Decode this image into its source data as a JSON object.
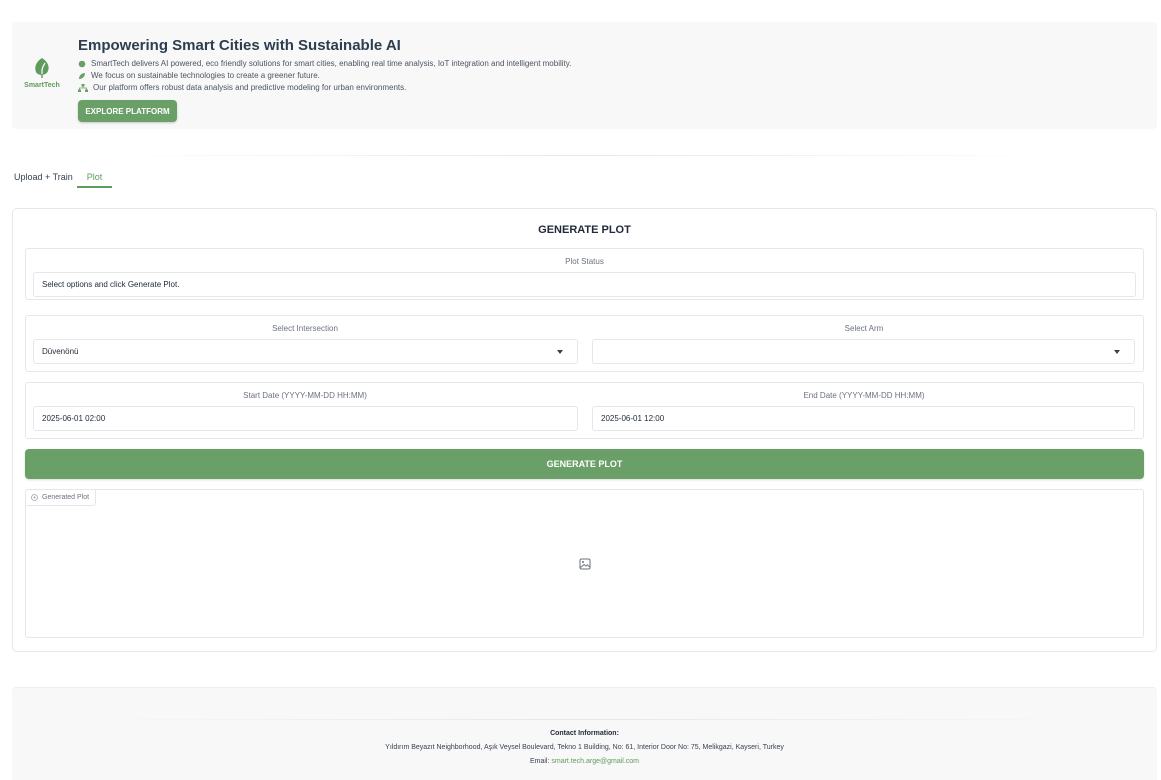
{
  "hero": {
    "logo_text": "SmartTech",
    "title": "Empowering Smart Cities with Sustainable AI",
    "lines": [
      "SmartTech delivers AI powered, eco friendly solutions for smart cities, enabling real time analysis, IoT integration and intelligent mobility.",
      "We focus on sustainable technologies to create a greener future.",
      "Our platform offers robust data analysis and predictive modeling for urban environments."
    ],
    "cta_label": "EXPLORE PLATFORM"
  },
  "tabs": [
    {
      "label": "Upload + Train",
      "active": false
    },
    {
      "label": "Plot",
      "active": true
    }
  ],
  "panel": {
    "title": "GENERATE PLOT",
    "status": {
      "label": "Plot Status",
      "value": "Select options and click Generate Plot."
    },
    "intersection": {
      "label": "Select Intersection",
      "value": "Düvenönü"
    },
    "arm": {
      "label": "Select Arm",
      "value": ""
    },
    "start_date": {
      "label": "Start Date (YYYY-MM-DD HH:MM)",
      "value": "2025-06-01 02:00"
    },
    "end_date": {
      "label": "End Date (YYYY-MM-DD HH:MM)",
      "value": "2025-06-01 12:00"
    },
    "generate_label": "GENERATE PLOT",
    "plot_label": "Generated Plot"
  },
  "footer": {
    "title": "Contact Information:",
    "address": "Yıldırım Beyazıt Neighborhood, Aşık Veysel Boulevard, Tekno 1 Building, No: 61, Interior Door No: 75, Melikgazi, Kayseri, Turkey",
    "email_prefix": "Email:",
    "email": "smart.tech.arge@gmail.com"
  },
  "colors": {
    "accent": "#6a9f68",
    "accent_text": "#5f9b5c"
  }
}
